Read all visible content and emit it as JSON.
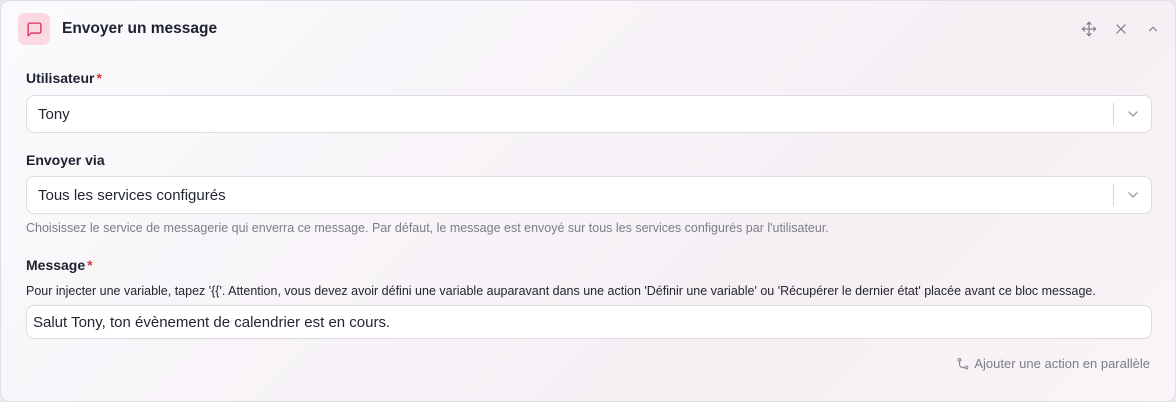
{
  "header": {
    "title": "Envoyer un message",
    "icon": "message-square-icon",
    "accent": "#fbd8e2"
  },
  "user_field": {
    "label": "Utilisateur",
    "required_mark": "*",
    "value": "Tony"
  },
  "send_via_field": {
    "label": "Envoyer via",
    "value": "Tous les services configurés",
    "help": "Choisissez le service de messagerie qui enverra ce message. Par défaut, le message est envoyé sur tous les services configurés par l'utilisateur."
  },
  "message_field": {
    "label": "Message",
    "required_mark": "*",
    "hint": "Pour injecter une variable, tapez '{{'. Attention, vous devez avoir défini une variable auparavant dans une action 'Définir une variable' ou 'Récupérer le dernier état' placée avant ce bloc message.",
    "value": "Salut Tony, ton évènement de calendrier est en cours."
  },
  "footer": {
    "parallel_label": "Ajouter une action en parallèle"
  }
}
